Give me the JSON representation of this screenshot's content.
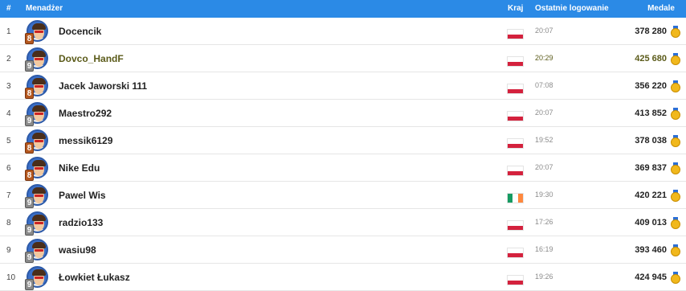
{
  "headers": {
    "num": "#",
    "manager": "Menadżer",
    "country": "Kraj",
    "last_login": "Ostatnie logowanie",
    "medals": "Medale"
  },
  "colors": {
    "header_bg": "#2b8ae6",
    "highlight_text": "#5b5b1a",
    "flag_pl_red": "#d4213d",
    "medal_gold": "#f1b81c"
  },
  "rows": [
    {
      "rank": "1",
      "name": "Docencik",
      "level": "8",
      "level_tier": "bronze",
      "country": "PL",
      "login": "20:07",
      "medals": "378 280",
      "highlight": false
    },
    {
      "rank": "2",
      "name": "Dovco_HandF",
      "level": "9",
      "level_tier": "silver",
      "country": "PL",
      "login": "20:29",
      "medals": "425 680",
      "highlight": true
    },
    {
      "rank": "3",
      "name": "Jacek Jaworski 111",
      "level": "8",
      "level_tier": "bronze",
      "country": "PL",
      "login": "07:08",
      "medals": "356 220",
      "highlight": false
    },
    {
      "rank": "4",
      "name": "Maestro292",
      "level": "9",
      "level_tier": "silver",
      "country": "PL",
      "login": "20:07",
      "medals": "413 852",
      "highlight": false
    },
    {
      "rank": "5",
      "name": "messik6129",
      "level": "8",
      "level_tier": "bronze",
      "country": "PL",
      "login": "19:52",
      "medals": "378 038",
      "highlight": false
    },
    {
      "rank": "6",
      "name": "Nike Edu",
      "level": "8",
      "level_tier": "bronze",
      "country": "PL",
      "login": "20:07",
      "medals": "369 837",
      "highlight": false
    },
    {
      "rank": "7",
      "name": "Pawel Wis",
      "level": "9",
      "level_tier": "silver",
      "country": "IE",
      "login": "19:30",
      "medals": "420 221",
      "highlight": false
    },
    {
      "rank": "8",
      "name": "radzio133",
      "level": "9",
      "level_tier": "silver",
      "country": "PL",
      "login": "17:26",
      "medals": "409 013",
      "highlight": false
    },
    {
      "rank": "9",
      "name": "wasiu98",
      "level": "9",
      "level_tier": "silver",
      "country": "PL",
      "login": "16:19",
      "medals": "393 460",
      "highlight": false
    },
    {
      "rank": "10",
      "name": "Łowkiet Łukasz",
      "level": "9",
      "level_tier": "silver",
      "country": "PL",
      "login": "19:26",
      "medals": "424 945",
      "highlight": false
    }
  ]
}
